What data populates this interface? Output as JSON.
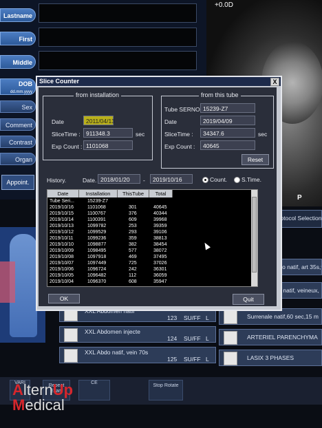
{
  "patient": {
    "labels": [
      "Lastname",
      "First",
      "Middle",
      "DOB",
      "Sex",
      "Comment",
      "Contrast",
      "Organ"
    ],
    "dob_format": "dd.mm.yyyy",
    "appoint_label": "Appoint."
  },
  "ct_readout": "+0.0D",
  "ct_marker": "P",
  "dialog": {
    "title": "Slice Counter",
    "close": "X",
    "installation": {
      "legend": "from installation",
      "date_label": "Date",
      "date_value": "2011/04/13",
      "slicetime_label": "SliceTime :",
      "slicetime_value": "911348.3",
      "slicetime_unit": "sec",
      "expcount_label": "Exp Count :",
      "expcount_value": "1101068"
    },
    "tube": {
      "legend": "from this tube",
      "serno_label": "Tube SERNO",
      "serno_value": "15239-Z7",
      "date_label": "Date",
      "date_value": "2019/04/09",
      "slicetime_label": "SliceTime :",
      "slicetime_value": "34347.6",
      "slicetime_unit": "sec",
      "expcount_label": "Exp Count :",
      "expcount_value": "40645",
      "reset_label": "Reset"
    },
    "history": {
      "label": "History.",
      "date_label": "Date.",
      "from": "2018/01/20",
      "dash": "-",
      "to": "2019/10/16",
      "count_label": "Count.",
      "stime_label": "S.Time."
    },
    "table": {
      "headers": [
        "Date",
        "Installation",
        "ThisTube",
        "Total"
      ],
      "rows": [
        [
          "Tube Seri...",
          "15239-Z7",
          "",
          ""
        ],
        [
          "2019/10/16",
          "1101068",
          "301",
          "40645"
        ],
        [
          "2019/10/15",
          "1100767",
          "376",
          "40344"
        ],
        [
          "2019/10/14",
          "1100391",
          "609",
          "39968"
        ],
        [
          "2019/10/13",
          "1099782",
          "253",
          "39359"
        ],
        [
          "2019/10/12",
          "1099529",
          "293",
          "39106"
        ],
        [
          "2019/10/11",
          "1099236",
          "359",
          "38813"
        ],
        [
          "2019/10/10",
          "1098877",
          "382",
          "38454"
        ],
        [
          "2019/10/09",
          "1098495",
          "577",
          "38072"
        ],
        [
          "2019/10/08",
          "1097918",
          "469",
          "37495"
        ],
        [
          "2019/10/07",
          "1097449",
          "725",
          "37026"
        ],
        [
          "2019/10/06",
          "1096724",
          "242",
          "36301"
        ],
        [
          "2019/10/05",
          "1096482",
          "112",
          "36059"
        ],
        [
          "2019/10/04",
          "1096370",
          "608",
          "35947"
        ]
      ]
    },
    "ok_label": "OK",
    "quit_label": "Quit"
  },
  "protocols_left": [
    {
      "name": "XXL Abdomen natif",
      "num": "",
      "size": "",
      "letter": ""
    },
    {
      "name": "XXL Abdomen injecte",
      "num": "124",
      "size": "SU/FF",
      "letter": "L"
    },
    {
      "name": "XXL Abdo natif, vein 70s",
      "num": "125",
      "size": "SU/FF",
      "letter": "L"
    }
  ],
  "protocol_row_first": {
    "num": "123",
    "size": "SU/FF",
    "letter": "L"
  },
  "protocols_right": [
    {
      "name": "Protocol Selection"
    },
    {
      "name": "Abdo natif, art 35s,ve"
    },
    {
      "name": "-CT natif, veineux,"
    },
    {
      "name": "Surrenale natif,60 sec,15 m"
    },
    {
      "name": "ARTERIEL PARENCHYMA"
    },
    {
      "name": "LASIX 3 PHASES"
    }
  ],
  "bottom": {
    "vari": "VARI",
    "repeat": "Repeat Exam",
    "ce": "CE",
    "stop": "Stop Rotate"
  },
  "logo": {
    "line1_red": "A",
    "line1_rest": "ltern",
    "line1_red2": "Up",
    "line2_red": "M",
    "line2_rest": "edical"
  }
}
